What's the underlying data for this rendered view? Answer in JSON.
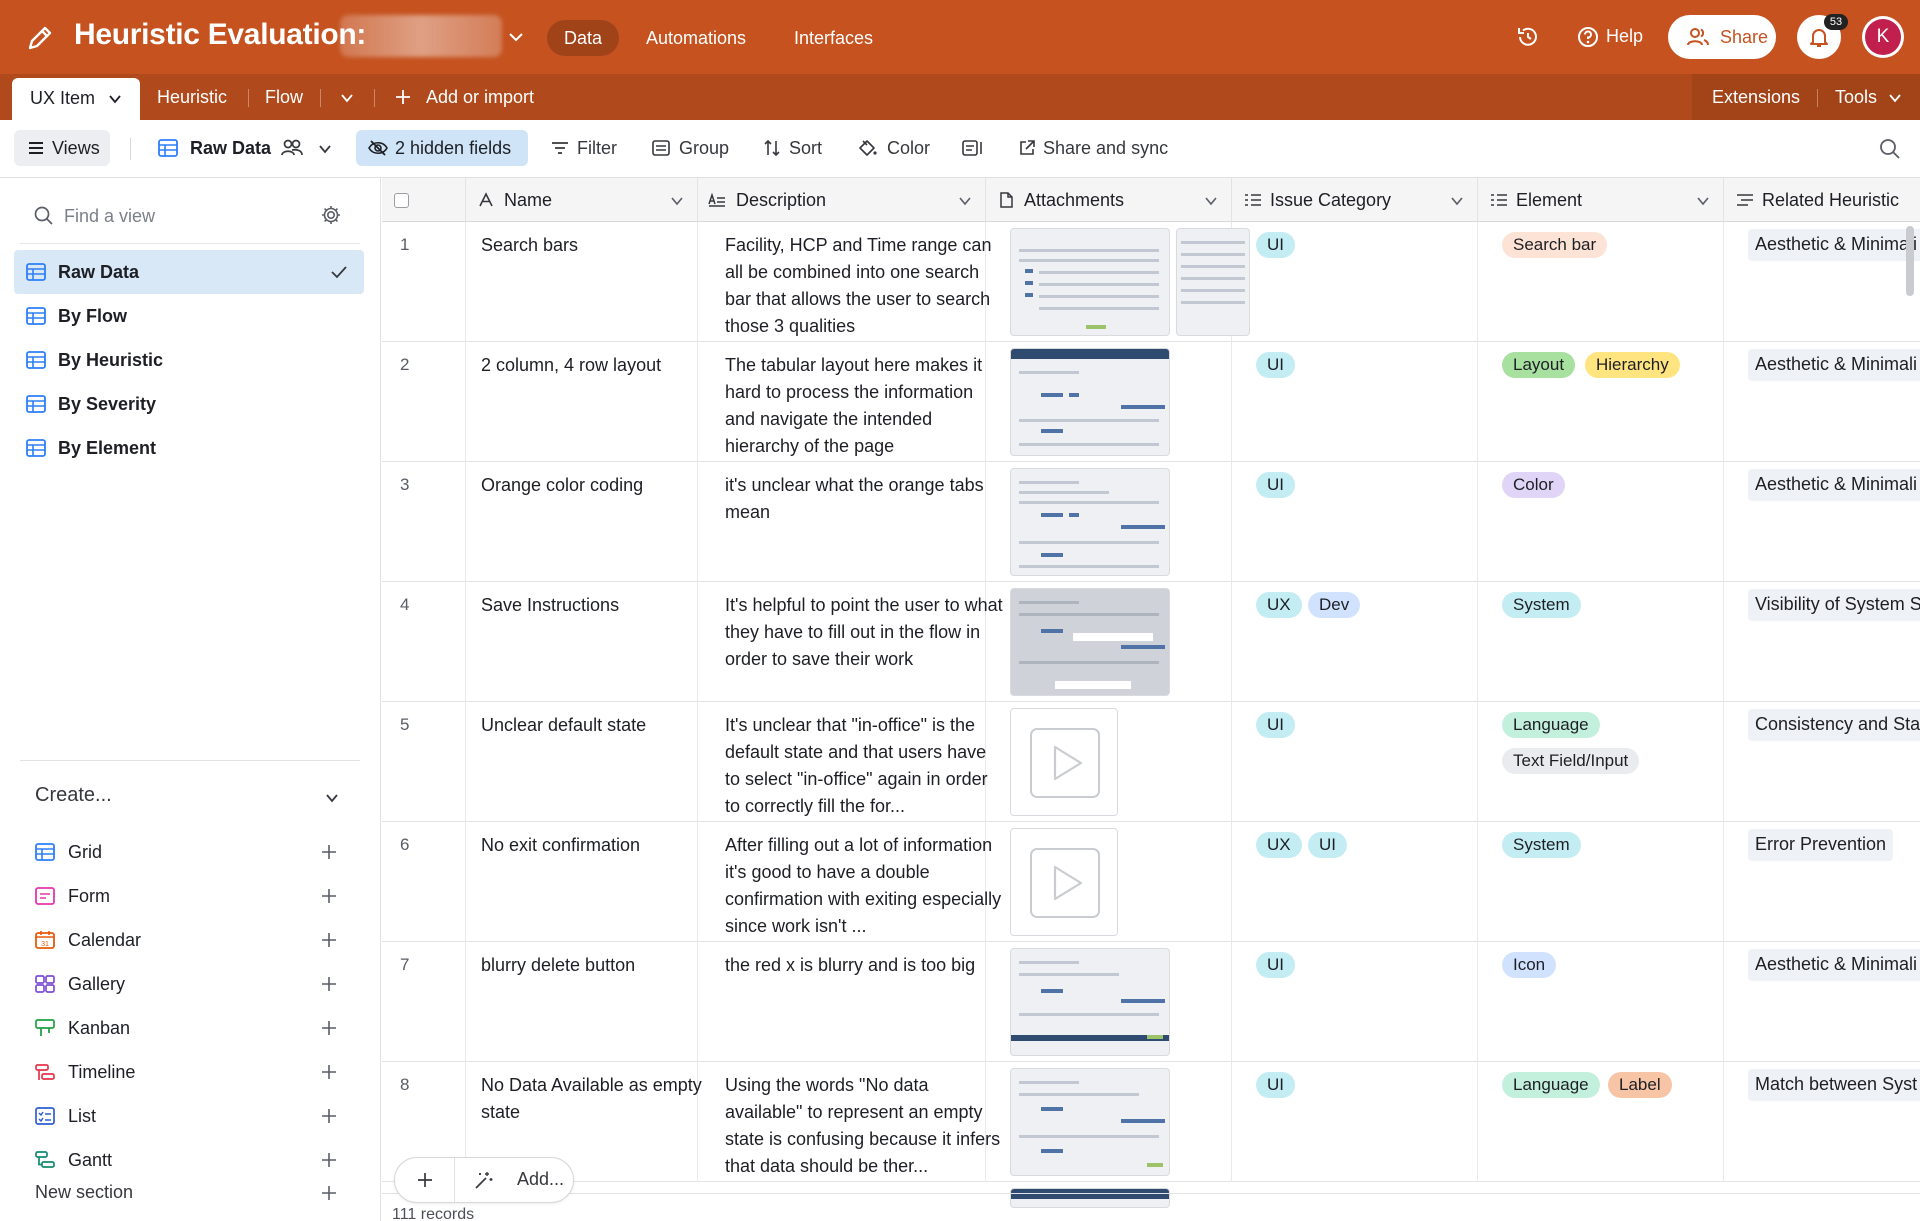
{
  "topbar": {
    "base_title": "Heuristic Evaluation:",
    "nav": [
      "Data",
      "Automations",
      "Interfaces"
    ],
    "help_label": "Help",
    "share_label": "Share",
    "notification_count": "53",
    "avatar_initial": "K"
  },
  "tables": {
    "active_tab": "UX Item",
    "tabs": [
      "Heuristic",
      "Flow"
    ],
    "add_label": "Add or import",
    "extensions_label": "Extensions",
    "tools_label": "Tools"
  },
  "toolbar": {
    "views_label": "Views",
    "current_view": "Raw Data",
    "hidden_fields": "2 hidden fields",
    "filter": "Filter",
    "group": "Group",
    "sort": "Sort",
    "color": "Color",
    "share_sync": "Share and sync"
  },
  "sidebar": {
    "find_placeholder": "Find a view",
    "views": [
      "Raw Data",
      "By Flow",
      "By Heuristic",
      "By Severity",
      "By Element"
    ],
    "create_title": "Create...",
    "create_items": [
      {
        "label": "Grid",
        "color": "#2d7ff9"
      },
      {
        "label": "Form",
        "color": "#e535ab"
      },
      {
        "label": "Calendar",
        "color": "#e8590c"
      },
      {
        "label": "Gallery",
        "color": "#7c4dd8"
      },
      {
        "label": "Kanban",
        "color": "#20a144"
      },
      {
        "label": "Timeline",
        "color": "#e3344a"
      },
      {
        "label": "List",
        "color": "#2d5fd0"
      },
      {
        "label": "Gantt",
        "color": "#138a72"
      }
    ],
    "new_section": "New section"
  },
  "grid": {
    "headers": {
      "name": "Name",
      "description": "Description",
      "attachments": "Attachments",
      "issue_category": "Issue Category",
      "element": "Element",
      "related_heuristic": "Related Heuristic"
    },
    "rows": [
      {
        "num": "1",
        "name": "Search bars",
        "description": "Facility, HCP and Time range can all be combined into one search bar that allows the user to search those 3 qualities",
        "issue": [
          "UI"
        ],
        "elements": [
          "Search bar"
        ],
        "heuristic": "Aesthetic & Minimali"
      },
      {
        "num": "2",
        "name": "2 column, 4 row layout",
        "description": "The tabular layout here makes it hard to process the information and navigate the intended hierarchy of the page",
        "issue": [
          "UI"
        ],
        "elements": [
          "Layout",
          "Hierarchy"
        ],
        "heuristic": "Aesthetic & Minimali"
      },
      {
        "num": "3",
        "name": "Orange color coding",
        "description": "it's unclear what the orange tabs mean",
        "issue": [
          "UI"
        ],
        "elements": [
          "Color"
        ],
        "heuristic": "Aesthetic & Minimali"
      },
      {
        "num": "4",
        "name": "Save Instructions",
        "description": "It's helpful to point the user to what they have to fill out in the flow in order to save their work",
        "issue": [
          "UX",
          "Dev"
        ],
        "elements": [
          "System"
        ],
        "heuristic": "Visibility of System S"
      },
      {
        "num": "5",
        "name": "Unclear default state",
        "description": "It's unclear that \"in-office\" is the default state and that users have to select \"in-office\" again in order to correctly fill the for...",
        "issue": [
          "UI"
        ],
        "elements": [
          "Language",
          "Text Field/Input"
        ],
        "heuristic": "Consistency and Sta"
      },
      {
        "num": "6",
        "name": "No exit confirmation",
        "description": "After filling out a lot of information it's good to have a double confirmation with exiting especially since work isn't ...",
        "issue": [
          "UX",
          "UI"
        ],
        "elements": [
          "System"
        ],
        "heuristic": "Error Prevention"
      },
      {
        "num": "7",
        "name": "blurry delete button",
        "description": "the red x is blurry and is too big",
        "issue": [
          "UI"
        ],
        "elements": [
          "Icon"
        ],
        "heuristic": "Aesthetic & Minimali"
      },
      {
        "num": "8",
        "name": "No Data Available as empty state",
        "description": "Using the words \"No data available\" to represent an empty state is confusing because it infers that data should be ther...",
        "issue": [
          "UI"
        ],
        "elements": [
          "Language",
          "Label"
        ],
        "heuristic": "Match between Syst"
      }
    ],
    "add_label": "Add...",
    "records": "111 records"
  },
  "colors": {
    "brand": "#c5521f",
    "selected_view_bg": "#d8e8f7",
    "hidden_fields_bg": "#cfe4f7"
  }
}
